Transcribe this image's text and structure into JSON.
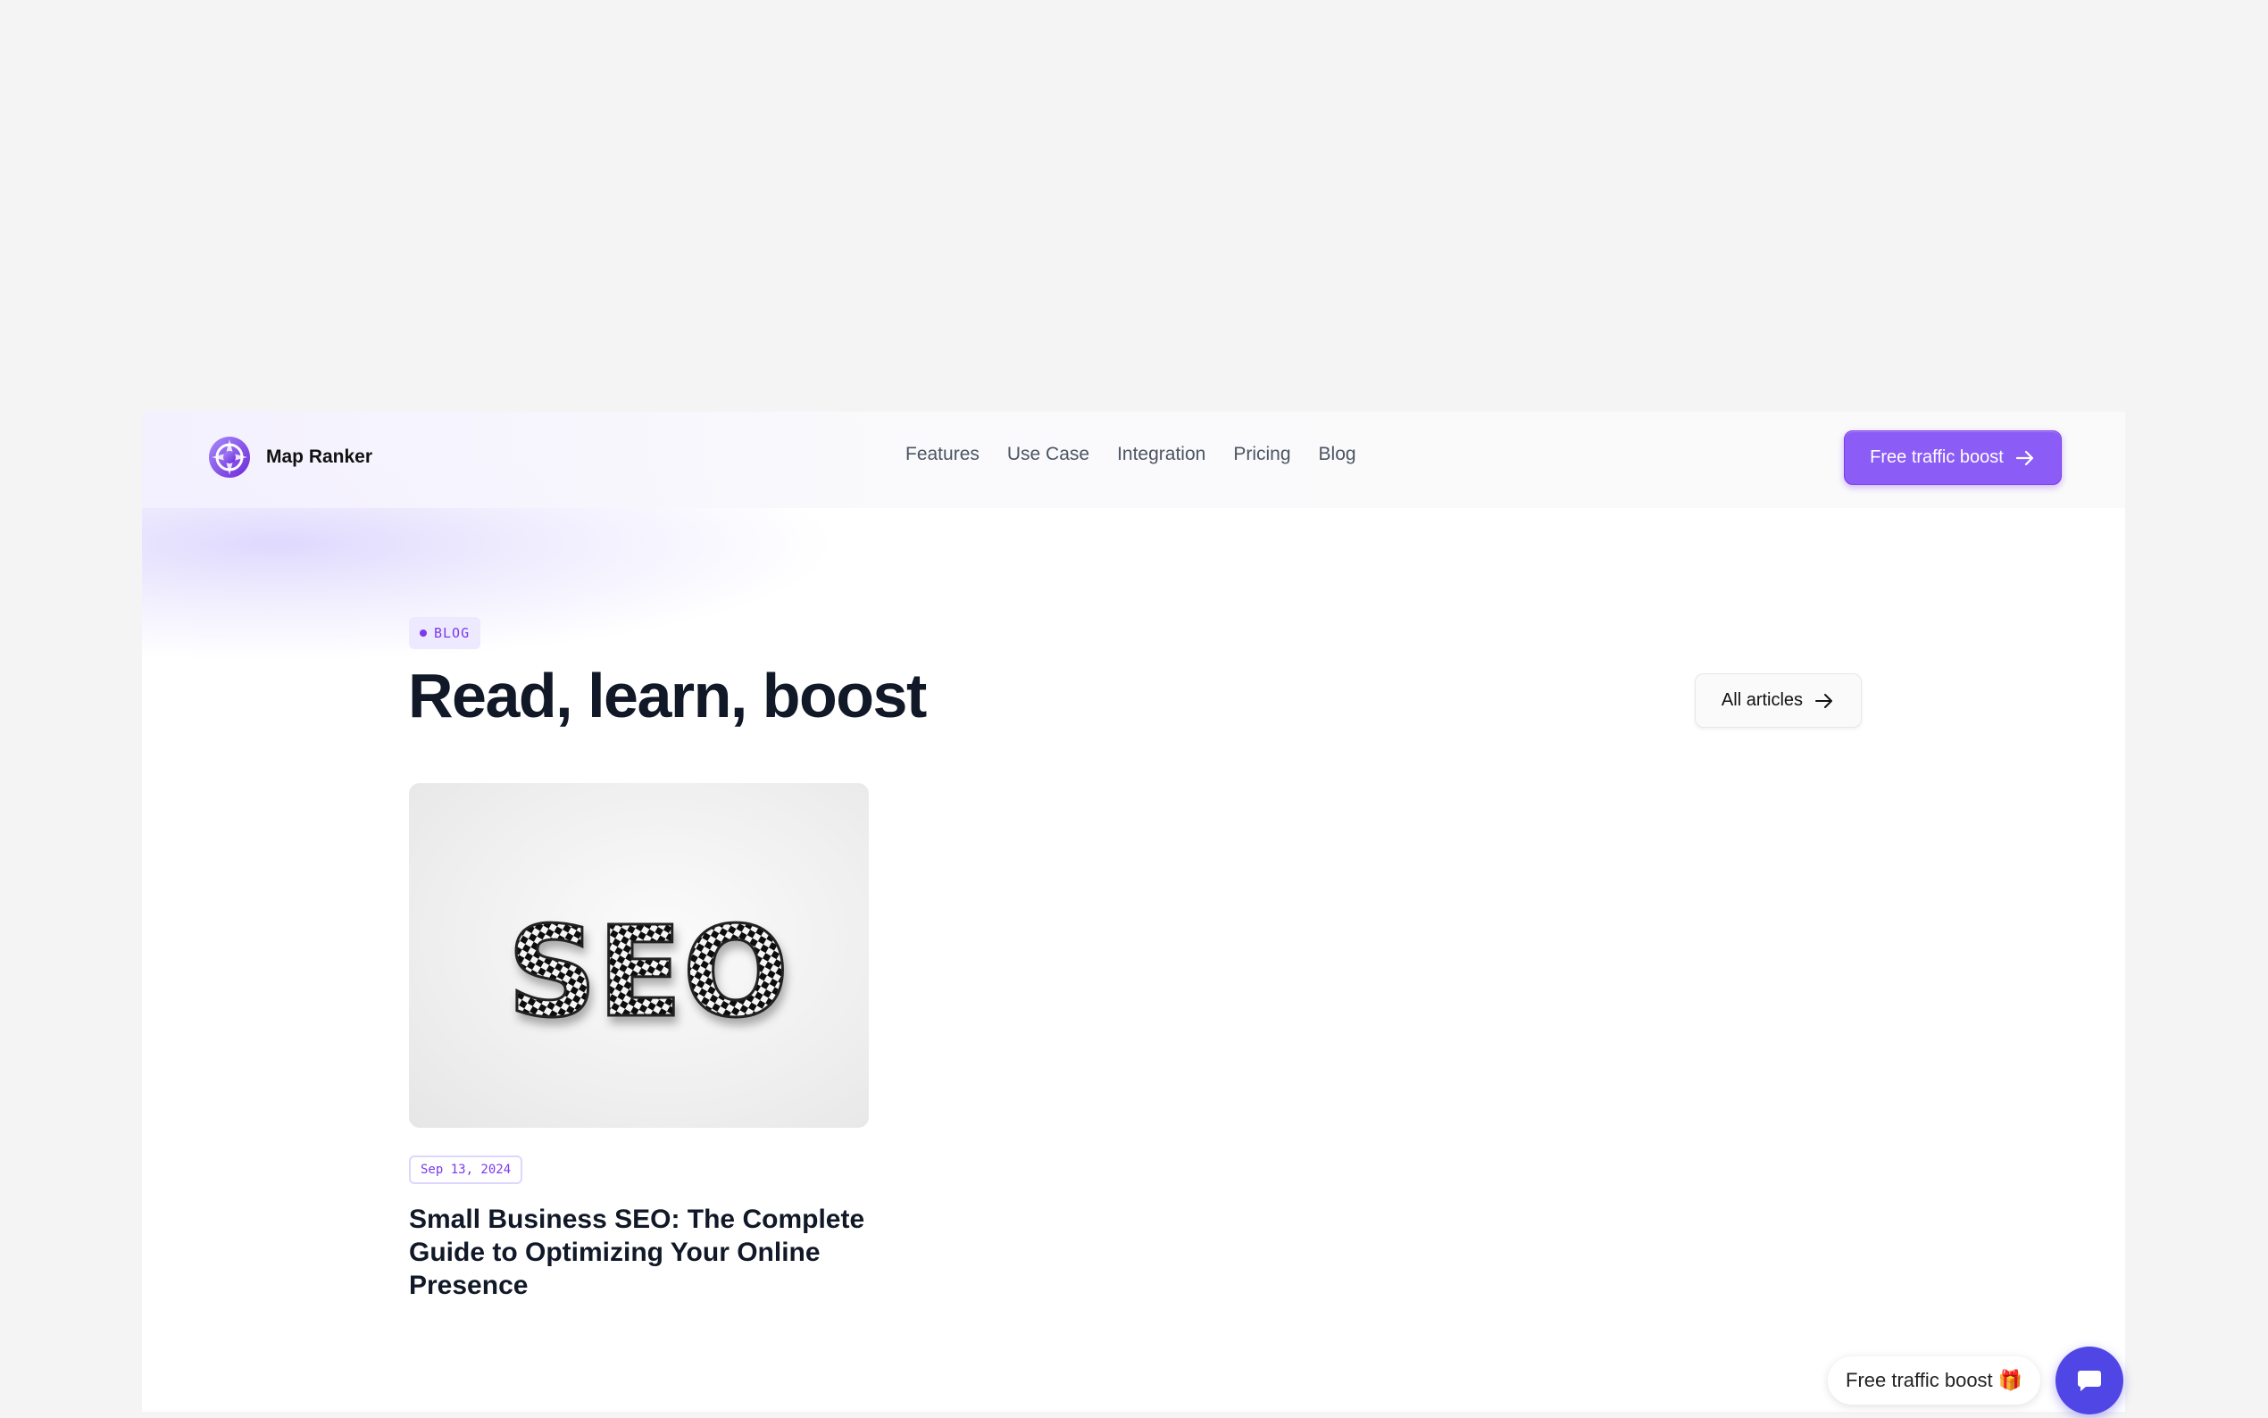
{
  "brand": {
    "name": "Map Ranker",
    "logo_icon": "map-ranker-logo-icon",
    "accent": "#8b5cf6"
  },
  "nav": {
    "links": [
      "Features",
      "Use Case",
      "Integration",
      "Pricing",
      "Blog"
    ],
    "cta_label": "Free traffic boost"
  },
  "hero": {
    "badge": "BLOG",
    "title": "Read, learn, boost",
    "all_articles_label": "All articles"
  },
  "posts": [
    {
      "image_text": "SEO",
      "date": "Sep 13, 2024",
      "title": "Small Business SEO: The Complete Guide to Optimizing Your Online Presence"
    }
  ],
  "widget": {
    "pill_label": "Free traffic boost 🎁",
    "chat_icon": "chat-bubble-icon",
    "chat_color": "#4f46e5"
  }
}
